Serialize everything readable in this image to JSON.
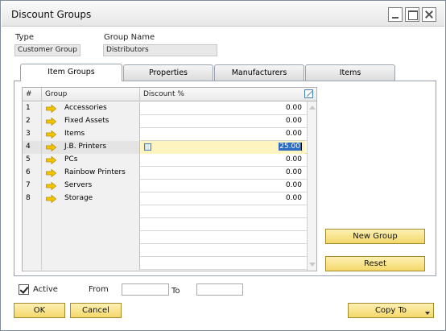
{
  "window": {
    "title": "Discount Groups"
  },
  "header": {
    "type_label": "Type",
    "type_value": "Customer Group",
    "group_name_label": "Group Name",
    "group_name_value": "Distributors"
  },
  "tabs": [
    {
      "label": "Item Groups",
      "active": true
    },
    {
      "label": "Properties",
      "active": false
    },
    {
      "label": "Manufacturers",
      "active": false
    },
    {
      "label": "Items",
      "active": false
    }
  ],
  "grid": {
    "columns": {
      "num": "#",
      "group": "Group",
      "discount": "Discount %"
    },
    "rows": [
      {
        "num": "1",
        "group": "Accessories",
        "discount": "0.00"
      },
      {
        "num": "2",
        "group": "Fixed Assets",
        "discount": "0.00"
      },
      {
        "num": "3",
        "group": "Items",
        "discount": "0.00"
      },
      {
        "num": "4",
        "group": "J.B. Printers",
        "discount": "25.00"
      },
      {
        "num": "5",
        "group": "PCs",
        "discount": "0.00"
      },
      {
        "num": "6",
        "group": "Rainbow Printers",
        "discount": "0.00"
      },
      {
        "num": "7",
        "group": "Servers",
        "discount": "0.00"
      },
      {
        "num": "8",
        "group": "Storage",
        "discount": "0.00"
      }
    ]
  },
  "buttons": {
    "new_group": "New Group",
    "reset": "Reset",
    "ok": "OK",
    "cancel": "Cancel",
    "copy_to": "Copy To"
  },
  "footer": {
    "active_label": "Active",
    "from_label": "From",
    "to_label": "To",
    "from_value": "",
    "to_value": ""
  },
  "colors": {
    "button_gold": "#f4d86a",
    "selected_row": "#fdf4bf",
    "arrow_yellow": "#f5c400"
  }
}
